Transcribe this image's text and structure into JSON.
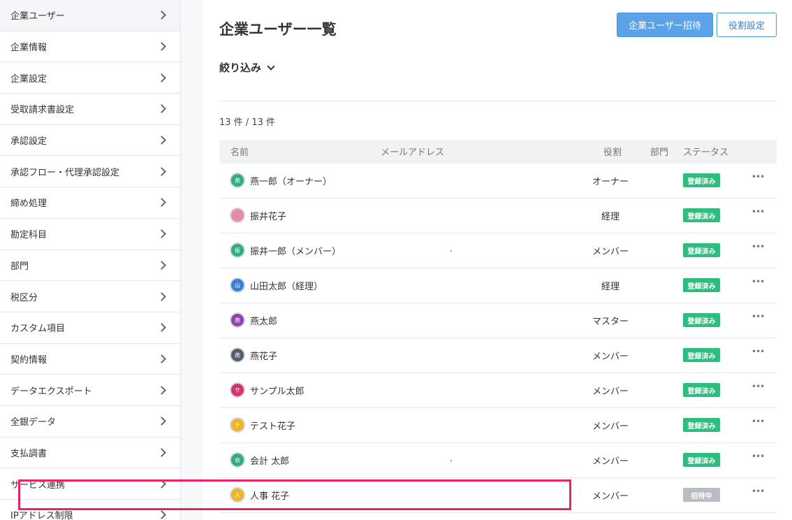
{
  "sidebar": {
    "items": [
      {
        "label": "企業ユーザー"
      },
      {
        "label": "企業情報"
      },
      {
        "label": "企業設定"
      },
      {
        "label": "受取請求書設定"
      },
      {
        "label": "承認設定"
      },
      {
        "label": "承認フロー・代理承認設定"
      },
      {
        "label": "締め処理"
      },
      {
        "label": "勘定科目"
      },
      {
        "label": "部門"
      },
      {
        "label": "税区分"
      },
      {
        "label": "カスタム項目"
      },
      {
        "label": "契約情報"
      },
      {
        "label": "データエクスポート"
      },
      {
        "label": "全銀データ"
      },
      {
        "label": "支払調書"
      },
      {
        "label": "サービス連携"
      },
      {
        "label": "IPアドレス制限"
      }
    ]
  },
  "header": {
    "title": "企業ユーザー一覧",
    "invite_button": "企業ユーザー招待",
    "role_settings_button": "役割設定"
  },
  "filter": {
    "label": "絞り込み"
  },
  "count_text": "13 件 / 13 件",
  "table": {
    "columns": {
      "name": "名前",
      "email": "メールアドレス",
      "role": "役割",
      "dept": "部門",
      "status": "ステータス"
    },
    "rows": [
      {
        "avatar": "燕",
        "avatar_color": "#2fae7a",
        "name": "燕一郎（オーナー）",
        "email": "",
        "role": "オーナー",
        "status": "登録済み"
      },
      {
        "avatar": "",
        "avatar_color": "#e88aa6",
        "name": "振井花子",
        "email": "",
        "role": "経理",
        "status": "登録済み"
      },
      {
        "avatar": "振",
        "avatar_color": "#2fae7a",
        "name": "振井一郎（メンバー）",
        "email": ".",
        "role": "メンバー",
        "status": "登録済み"
      },
      {
        "avatar": "山",
        "avatar_color": "#3a7fd6",
        "name": "山田太郎（経理）",
        "email": "",
        "role": "経理",
        "status": "登録済み"
      },
      {
        "avatar": "燕",
        "avatar_color": "#8e44ad",
        "name": "燕太郎",
        "email": "",
        "role": "マスター",
        "status": "登録済み"
      },
      {
        "avatar": "燕",
        "avatar_color": "#555e68",
        "name": "燕花子",
        "email": "",
        "role": "メンバー",
        "status": "登録済み"
      },
      {
        "avatar": "サ",
        "avatar_color": "#d6336c",
        "name": "サンプル太郎",
        "email": "",
        "role": "メンバー",
        "status": "登録済み"
      },
      {
        "avatar": "テ",
        "avatar_color": "#f0b429",
        "name": "テスト花子",
        "email": "",
        "role": "メンバー",
        "status": "登録済み"
      },
      {
        "avatar": "会",
        "avatar_color": "#2fae7a",
        "name": "会計 太郎",
        "email": ".",
        "role": "メンバー",
        "status": "登録済み"
      },
      {
        "avatar": "人",
        "avatar_color": "#f0b429",
        "name": "人事 花子",
        "email": "",
        "role": "メンバー",
        "status": "招待中"
      }
    ],
    "more_glyph": "•••"
  },
  "colors": {
    "registered": "#2ebd7e",
    "invited": "#b9bcc0",
    "primary": "#5aa3e8",
    "highlight": "#e8226b"
  }
}
